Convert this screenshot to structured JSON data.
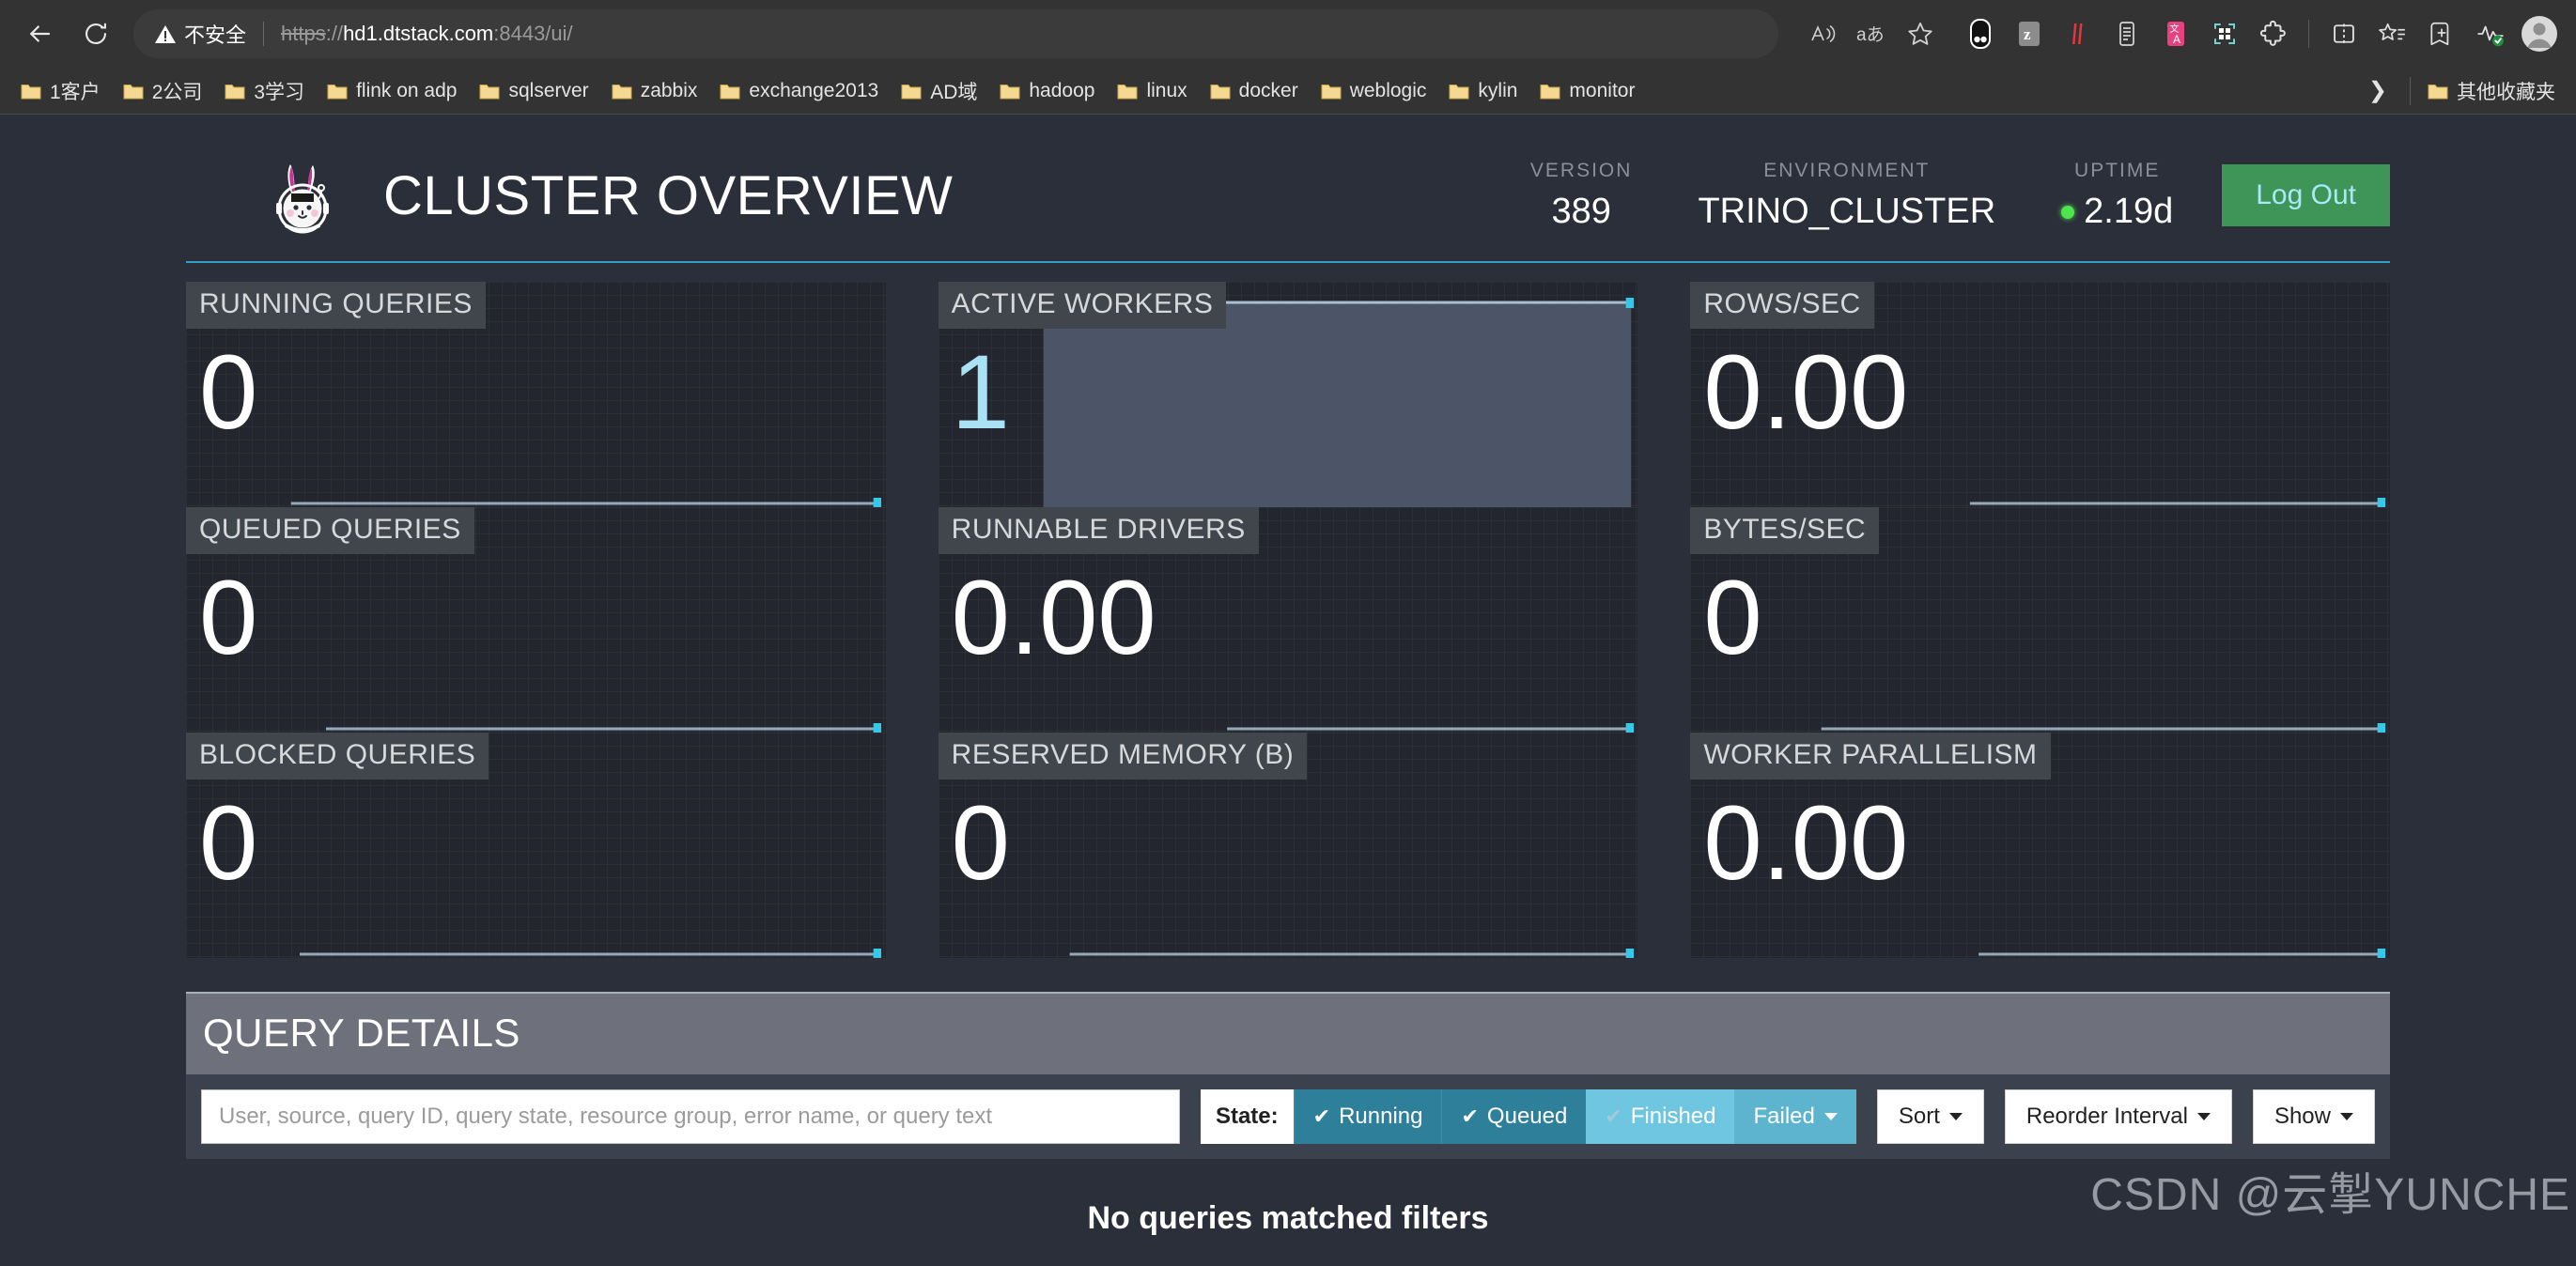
{
  "browser": {
    "nav": {
      "back_icon": "arrow-left-icon",
      "reload_icon": "reload-icon"
    },
    "omnibox": {
      "security_label": "不安全",
      "warning_icon": "warning-triangle-icon",
      "url_scheme": "https",
      "url_sep": "://",
      "url_host": "hd1.dtstack.com",
      "url_rest": ":8443/ui/",
      "read_aloud_icon": "read-aloud-icon",
      "translate_icon": "translate-icon",
      "favorite_icon": "star-outline-icon"
    },
    "toolbar_icons": [
      "collections-icon",
      "zhihu-extension-icon",
      "pdf-extension-icon",
      "clipboard-extension-icon",
      "translate-extension-icon",
      "qr-scan-extension-icon",
      "extensions-puzzle-icon",
      "split-screen-icon",
      "favorites-list-icon",
      "add-collection-icon",
      "browser-essentials-icon",
      "profile-avatar-icon"
    ],
    "bookmarks": [
      "1客户",
      "2公司",
      "3学习",
      "flink on adp",
      "sqlserver",
      "zabbix",
      "exchange2013",
      "AD域",
      "hadoop",
      "linux",
      "docker",
      "weblogic",
      "kylin",
      "monitor"
    ],
    "bookmarks_overflow_icon": "chevron-right-icon",
    "other_bookmarks": "其他收藏夹"
  },
  "header": {
    "logo_icon": "trino-rabbit-logo",
    "title": "CLUSTER OVERVIEW",
    "stats": [
      {
        "label": "VERSION",
        "value": "389",
        "has_dot": false
      },
      {
        "label": "ENVIRONMENT",
        "value": "TRINO_CLUSTER",
        "has_dot": false
      },
      {
        "label": "UPTIME",
        "value": "2.19d",
        "has_dot": true
      }
    ],
    "logout_label": "Log Out",
    "accent_color": "#30a0c8",
    "logout_bg": "#3f9458",
    "logout_fg": "#a9e8f5",
    "uptime_dot_color": "#4ee44e"
  },
  "tiles": [
    {
      "label": "RUNNING QUERIES",
      "value": "0",
      "accent": false,
      "spark": "flat-right"
    },
    {
      "label": "ACTIVE WORKERS",
      "value": "1",
      "accent": true,
      "spark": "filled-block"
    },
    {
      "label": "ROWS/SEC",
      "value": "0.00",
      "accent": false,
      "spark": "flat-right"
    },
    {
      "label": "QUEUED QUERIES",
      "value": "0",
      "accent": false,
      "spark": "flat-right"
    },
    {
      "label": "RUNNABLE DRIVERS",
      "value": "0.00",
      "accent": false,
      "spark": "flat-right"
    },
    {
      "label": "BYTES/SEC",
      "value": "0",
      "accent": false,
      "spark": "flat-right"
    },
    {
      "label": "BLOCKED QUERIES",
      "value": "0",
      "accent": false,
      "spark": "flat-right"
    },
    {
      "label": "RESERVED MEMORY (B)",
      "value": "0",
      "accent": false,
      "spark": "flat-right"
    },
    {
      "label": "WORKER PARALLELISM",
      "value": "0.00",
      "accent": false,
      "spark": "flat-right"
    }
  ],
  "query_details": {
    "title": "QUERY DETAILS",
    "search_placeholder": "User, source, query ID, query state, resource group, error name, or query text",
    "search_value": "",
    "state_label": "State:",
    "state_filters": [
      {
        "label": "Running",
        "checked": true,
        "style": "on-dark",
        "caret": false
      },
      {
        "label": "Queued",
        "checked": true,
        "style": "on-dark",
        "caret": false
      },
      {
        "label": "Finished",
        "checked": true,
        "style": "on-light",
        "caret": false,
        "dim_check": true
      },
      {
        "label": "Failed",
        "checked": false,
        "style": "on-mid",
        "caret": true
      }
    ],
    "sort_label": "Sort",
    "reorder_label": "Reorder Interval",
    "show_label": "Show",
    "empty_message": "No queries matched filters"
  },
  "watermark": "CSDN @云掣YUNCHE"
}
